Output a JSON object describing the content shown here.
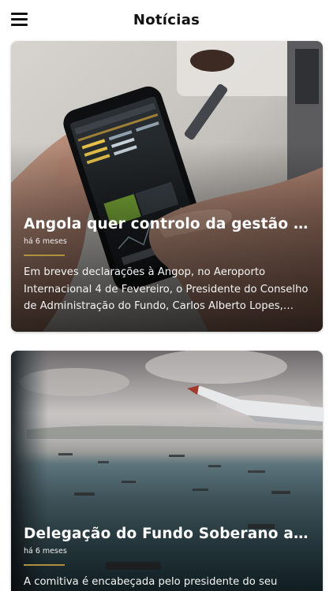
{
  "header": {
    "title": "Notícias",
    "menu_icon": "hamburger-menu-icon"
  },
  "articles": [
    {
      "title": "Angola quer controlo da gestão financeira",
      "date": "há 6 meses",
      "excerpt": "Em breves declarações à Angop, no Aeroporto Internacional 4 de Fevereiro, o Presidente do Conselho de Administração do Fundo, Carlos Alberto Lopes, disse que…",
      "image": "hands-holding-smartphone-stock-app-photo"
    },
    {
      "title": "Delegação do Fundo Soberano a caminho",
      "date": "há 6 meses",
      "excerpt": "A comitiva é encabeçada pelo presidente do seu",
      "image": "airplane-window-view-over-sea-photo"
    }
  ],
  "colors": {
    "accent_divider": "#b0903d",
    "title_text": "#111111",
    "card_text": "#ffffff"
  }
}
